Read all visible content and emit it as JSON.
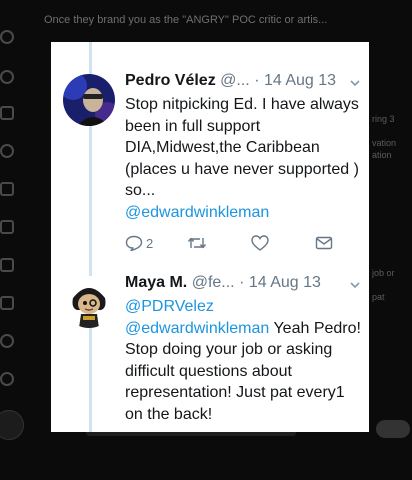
{
  "background": {
    "top_text": "Once they brand you as the \"ANGRY\" POC critic or artis...",
    "right_snippets": [
      "ring 3",
      "vation",
      "ation",
      "job or",
      "pat"
    ]
  },
  "tweets": [
    {
      "name": "Pedro Vélez",
      "handle": "@...",
      "separator": "·",
      "date": "14 Aug 13",
      "text": "Stop nitpicking Ed. I have always been in full support DIA,Midwest,the Caribbean (places u have never supported ) so...",
      "mention": "@edwardwinkleman",
      "reply_count": "2"
    },
    {
      "name": "Maya M.",
      "handle": "@fe...",
      "separator": "·",
      "date": "14 Aug 13",
      "mention_1": "@PDRVelez",
      "mention_2": "@edwardwinkleman",
      "text_after": " Yeah Pedro! Stop doing your job or asking difficult questions about representation! Just pat every1 on the back!"
    }
  ],
  "colors": {
    "mention": "#1b95e0",
    "meta": "#657786",
    "thread_line": "#cfe3f0"
  },
  "icons": [
    "reply-icon",
    "retweet-icon",
    "like-icon",
    "share-icon",
    "chevron-down-icon"
  ]
}
